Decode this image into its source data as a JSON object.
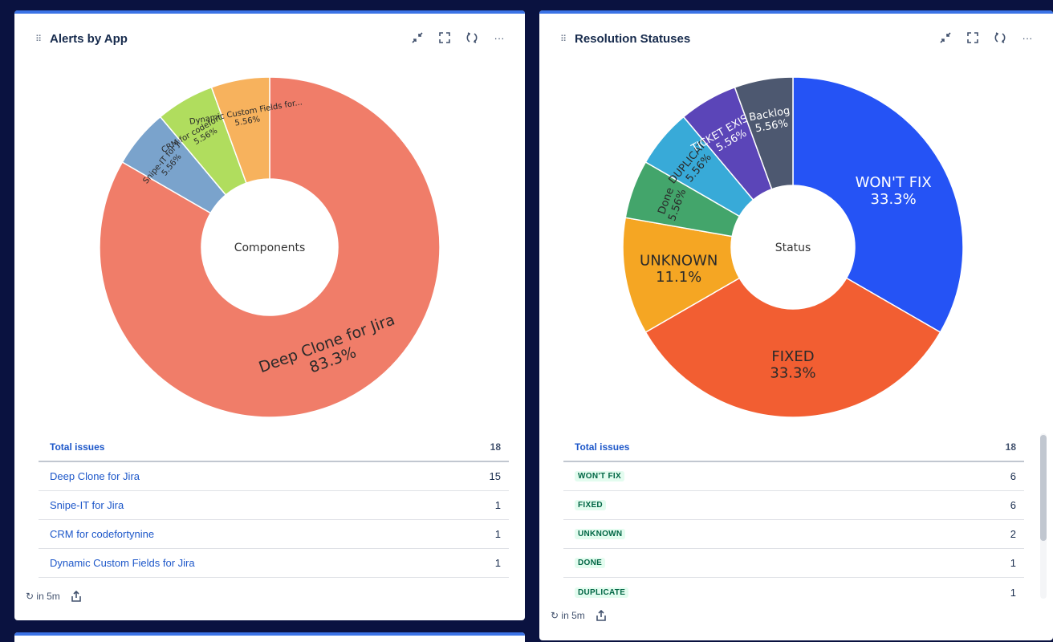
{
  "panels": [
    {
      "title": "Alerts by App",
      "chart_data": {
        "type": "pie",
        "center_label": "Components",
        "slices": [
          {
            "label": "Deep Clone for Jira",
            "value": 15,
            "pct": "83.3%",
            "color": "#f07d69"
          },
          {
            "label": "Snipe-IT for Jira",
            "value": 1,
            "pct": "5.56%",
            "color": "#7aa3cc"
          },
          {
            "label": "CRM for codefortynine",
            "value": 1,
            "pct": "5.56%",
            "color": "#b0dd5e"
          },
          {
            "label": "Dynamic Custom Fields for...",
            "value": 1,
            "pct": "5.56%",
            "color": "#f7b25d"
          }
        ]
      },
      "table": {
        "header": {
          "label": "Total issues",
          "count": "18"
        },
        "rows": [
          {
            "label": "Deep Clone for Jira",
            "count": "15"
          },
          {
            "label": "Snipe-IT for Jira",
            "count": "1"
          },
          {
            "label": "CRM for codefortynine",
            "count": "1"
          },
          {
            "label": "Dynamic Custom Fields for Jira",
            "count": "1"
          }
        ]
      },
      "refresh": "in 5m"
    },
    {
      "title": "Resolution Statuses",
      "chart_data": {
        "type": "pie",
        "center_label": "Status",
        "slices": [
          {
            "label": "WON'T FIX",
            "value": 6,
            "pct": "33.3%",
            "color": "#2553f5"
          },
          {
            "label": "FIXED",
            "value": 6,
            "pct": "33.3%",
            "color": "#f25e32"
          },
          {
            "label": "UNKNOWN",
            "value": 2,
            "pct": "11.1%",
            "color": "#f5a623"
          },
          {
            "label": "Done",
            "value": 1,
            "pct": "5.56%",
            "color": "#43a56b"
          },
          {
            "label": "DUPLICATE",
            "value": 1,
            "pct": "5.56%",
            "color": "#38aad8"
          },
          {
            "label": "TICKET EXISTS",
            "value": 1,
            "pct": "5.56%",
            "color": "#5b45b8"
          },
          {
            "label": "Backlog",
            "value": 1,
            "pct": "5.56%",
            "color": "#4d5870"
          }
        ]
      },
      "table": {
        "header": {
          "label": "Total issues",
          "count": "18"
        },
        "rows": [
          {
            "label": "WON'T FIX",
            "count": "6"
          },
          {
            "label": "FIXED",
            "count": "6"
          },
          {
            "label": "UNKNOWN",
            "count": "2"
          },
          {
            "label": "DONE",
            "count": "1"
          },
          {
            "label": "DUPLICATE",
            "count": "1"
          }
        ]
      },
      "refresh": "in 5m"
    }
  ],
  "icons": {
    "drag": "drag-handle-icon",
    "minimize": "minimize-icon",
    "fullscreen": "fullscreen-icon",
    "refresh": "refresh-icon",
    "more": "more-icon",
    "share": "share-icon"
  }
}
